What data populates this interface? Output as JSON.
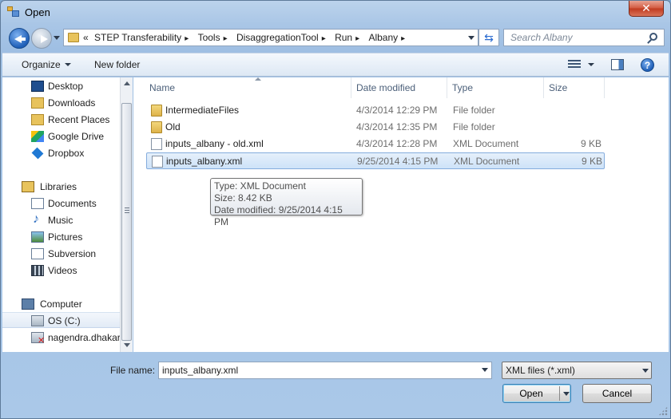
{
  "window": {
    "title": "Open",
    "close_glyph": "✕"
  },
  "address_bar": {
    "crumbs": [
      "«",
      "STEP Transferability",
      "Tools",
      "DisaggregationTool",
      "Run",
      "Albany"
    ],
    "separator": "▸"
  },
  "search": {
    "placeholder": "Search Albany"
  },
  "toolbar": {
    "organize_label": "Organize",
    "new_folder_label": "New folder",
    "help_glyph": "?"
  },
  "nav_pane": {
    "favorites": [
      "Desktop",
      "Downloads",
      "Recent Places",
      "Google Drive",
      "Dropbox"
    ],
    "libraries_label": "Libraries",
    "libraries": [
      "Documents",
      "Music",
      "Pictures",
      "Subversion",
      "Videos"
    ],
    "computer_label": "Computer",
    "computer": [
      "OS (C:)",
      "nagendra.dhakar"
    ]
  },
  "columns": {
    "name": "Name",
    "date_modified": "Date modified",
    "type": "Type",
    "size": "Size"
  },
  "files": [
    {
      "name": "IntermediateFiles",
      "date": "4/3/2014 12:29 PM",
      "type": "File folder",
      "size": "",
      "icon": "folder-icon"
    },
    {
      "name": "Old",
      "date": "4/3/2014 12:35 PM",
      "type": "File folder",
      "size": "",
      "icon": "folder-icon"
    },
    {
      "name": "inputs_albany - old.xml",
      "date": "4/3/2014 12:28 PM",
      "type": "XML Document",
      "size": "9 KB",
      "icon": "file-icon"
    },
    {
      "name": "inputs_albany.xml",
      "date": "9/25/2014 4:15 PM",
      "type": "XML Document",
      "size": "9 KB",
      "icon": "file-icon"
    }
  ],
  "tooltip": {
    "line1": "Type: XML Document",
    "line2": "Size: 8.42 KB",
    "line3": "Date modified: 9/25/2014 4:15 PM"
  },
  "bottom": {
    "file_name_label": "File name:",
    "file_name_value": "inputs_albany.xml",
    "filter_value": "XML files (*.xml)",
    "open_label": "Open",
    "cancel_label": "Cancel"
  },
  "colors": {
    "selection": "#cde2f8",
    "accent": "#3c7fb1",
    "chrome": "#a9c6e6"
  }
}
